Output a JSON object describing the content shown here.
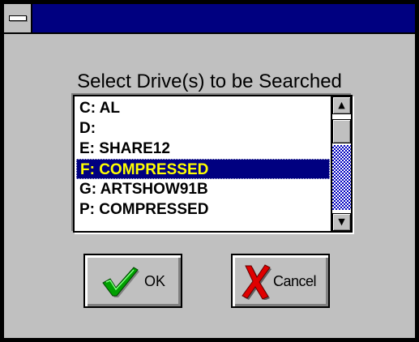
{
  "dialog": {
    "prompt": "Select Drive(s) to be Searched"
  },
  "drive_list": {
    "items": [
      {
        "label": "C: AL"
      },
      {
        "label": "D:"
      },
      {
        "label": "E: SHARE12"
      },
      {
        "label": "F: COMPRESSED",
        "selected": true
      },
      {
        "label": "G: ARTSHOW91B"
      },
      {
        "label": "P: COMPRESSED"
      }
    ],
    "scroll_up_glyph": "▲",
    "scroll_down_glyph": "▼"
  },
  "buttons": {
    "ok_label": "OK",
    "ok_icon": "checkmark-icon",
    "cancel_label": "Cancel",
    "cancel_icon": "red-x-icon"
  },
  "colors": {
    "title_bar": "#000080",
    "face": "#c0c0c0",
    "selection_bg": "#000080",
    "selection_text": "#ffff00",
    "check_green": "#00a000",
    "cancel_red": "#e00000"
  }
}
